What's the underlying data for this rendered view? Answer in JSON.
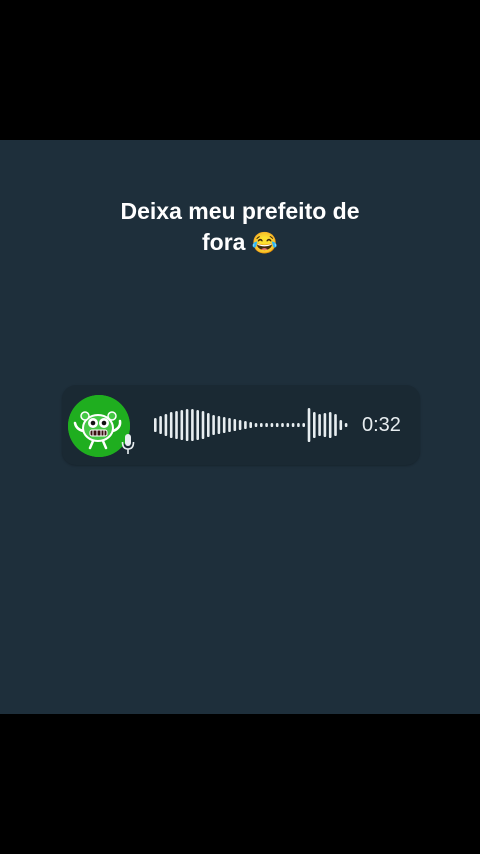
{
  "caption": {
    "line1": "Deixa meu prefeito de",
    "line2": "fora",
    "emoji": "😂"
  },
  "voice_message": {
    "duration": "0:32",
    "avatar_icon": "green-monster-sticker-icon",
    "mic_icon": "microphone-icon",
    "colors": {
      "bubble": "#1a2933",
      "avatar_bg": "#1fae1f",
      "background": "#1e2f3b"
    }
  }
}
